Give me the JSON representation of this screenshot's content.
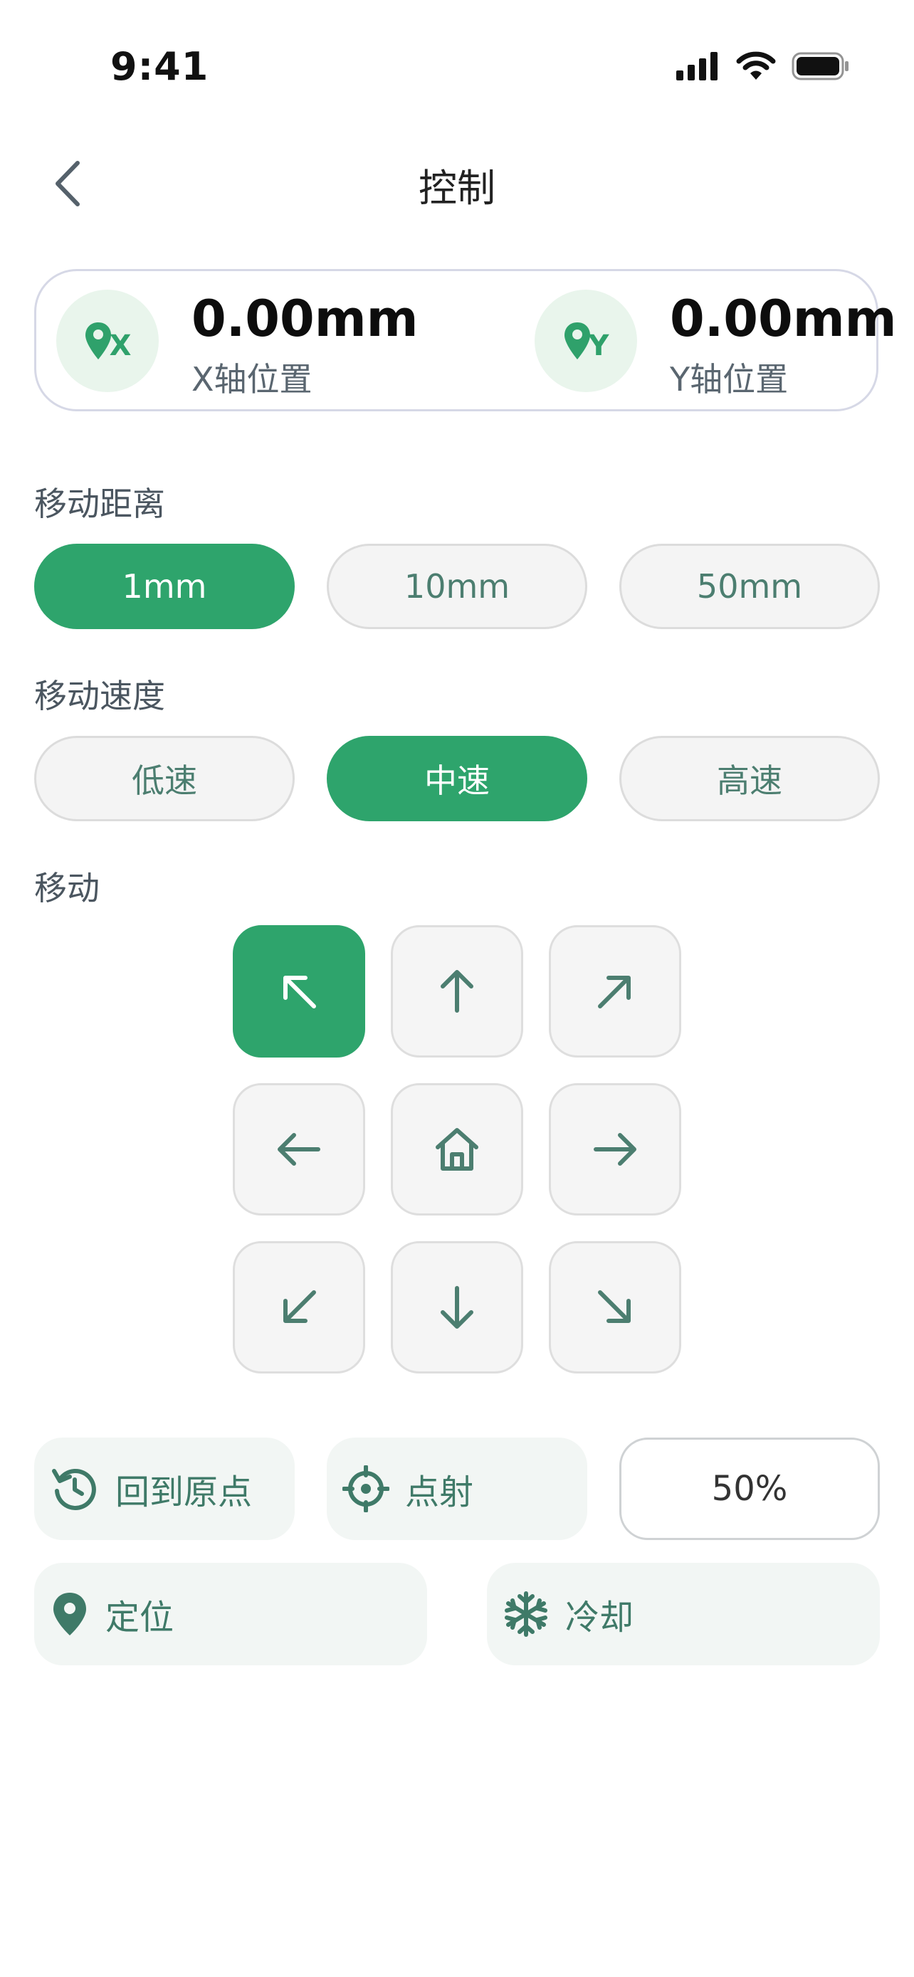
{
  "status_bar": {
    "time": "9:41"
  },
  "header": {
    "title": "控制"
  },
  "position": {
    "x": {
      "badge": "X",
      "value": "0.00mm",
      "label": "X轴位置"
    },
    "y": {
      "badge": "Y",
      "value": "0.00mm",
      "label": "Y轴位置"
    }
  },
  "distance": {
    "title": "移动距离",
    "options": [
      "1mm",
      "10mm",
      "50mm"
    ],
    "selected": "1mm"
  },
  "speed": {
    "title": "移动速度",
    "options": [
      "低速",
      "中速",
      "高速"
    ],
    "selected": "中速"
  },
  "move": {
    "title": "移动",
    "pad": [
      "up-left-arrow-icon",
      "up-arrow-icon",
      "up-right-arrow-icon",
      "left-arrow-icon",
      "home-icon",
      "right-arrow-icon",
      "down-left-arrow-icon",
      "down-arrow-icon",
      "down-right-arrow-icon"
    ],
    "active": "up-left-arrow-icon"
  },
  "actions": {
    "home_label": "回到原点",
    "fire_label": "点射",
    "power_value": "50%",
    "locate_label": "定位",
    "cool_label": "冷却"
  },
  "colors": {
    "accent": "#2ea46c",
    "icon": "#4c7e70",
    "badge_bg": "#e9f5ec",
    "button_bg": "#f4f4f4"
  }
}
